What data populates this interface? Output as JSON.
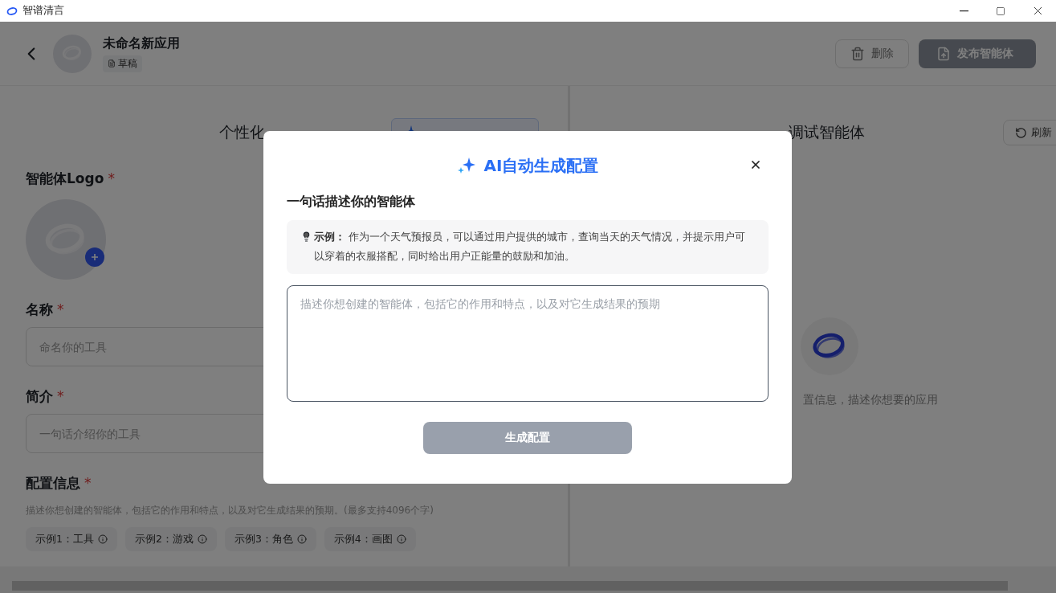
{
  "window": {
    "title": "智谱清言"
  },
  "header": {
    "app_name": "未命名新应用",
    "status": "草稿",
    "buttons": [
      {
        "label": "删除",
        "kind": "delete"
      },
      {
        "label": "发布智能体",
        "kind": "publish"
      }
    ]
  },
  "config_panel": {
    "title": "个性化",
    "logo_label": "智能体Logo",
    "logo_mark": "*",
    "fields": [
      {
        "label": "名称",
        "mark": "*",
        "placeholder": "命名你的工具"
      },
      {
        "label": "简介",
        "mark": "*",
        "placeholder": "一句话介绍你的工具"
      }
    ],
    "config": {
      "label": "配置信息",
      "mark": "*",
      "hint": "描述你想创建的智能体，包括它的作用和特点，以及对它生成结果的预期。(最多支持4096个字)",
      "examples": [
        "示例1：工具",
        "示例2：游戏",
        "示例3：角色",
        "示例4：画图"
      ]
    }
  },
  "debug_panel": {
    "title": "调试智能体",
    "refresh": "刷新",
    "empty_text": "置信息，描述你想要的应用"
  },
  "dialog": {
    "title": "AI自动生成配置",
    "prompt_label": "一句话描述你的智能体",
    "example_text": "**示例：** 作为一个天气预报员，可以通过用户提供的城市，查询当天的天气情况，并提示用户可以穿着的衣服搭配，同时给出用户正能量的鼓励和加油。",
    "input_placeholder": "描述你想创建的智能体，包括它的作用和特点，以及对它生成结果的预期",
    "submit": {
      "label": "生成配置",
      "disabled": true
    }
  }
}
